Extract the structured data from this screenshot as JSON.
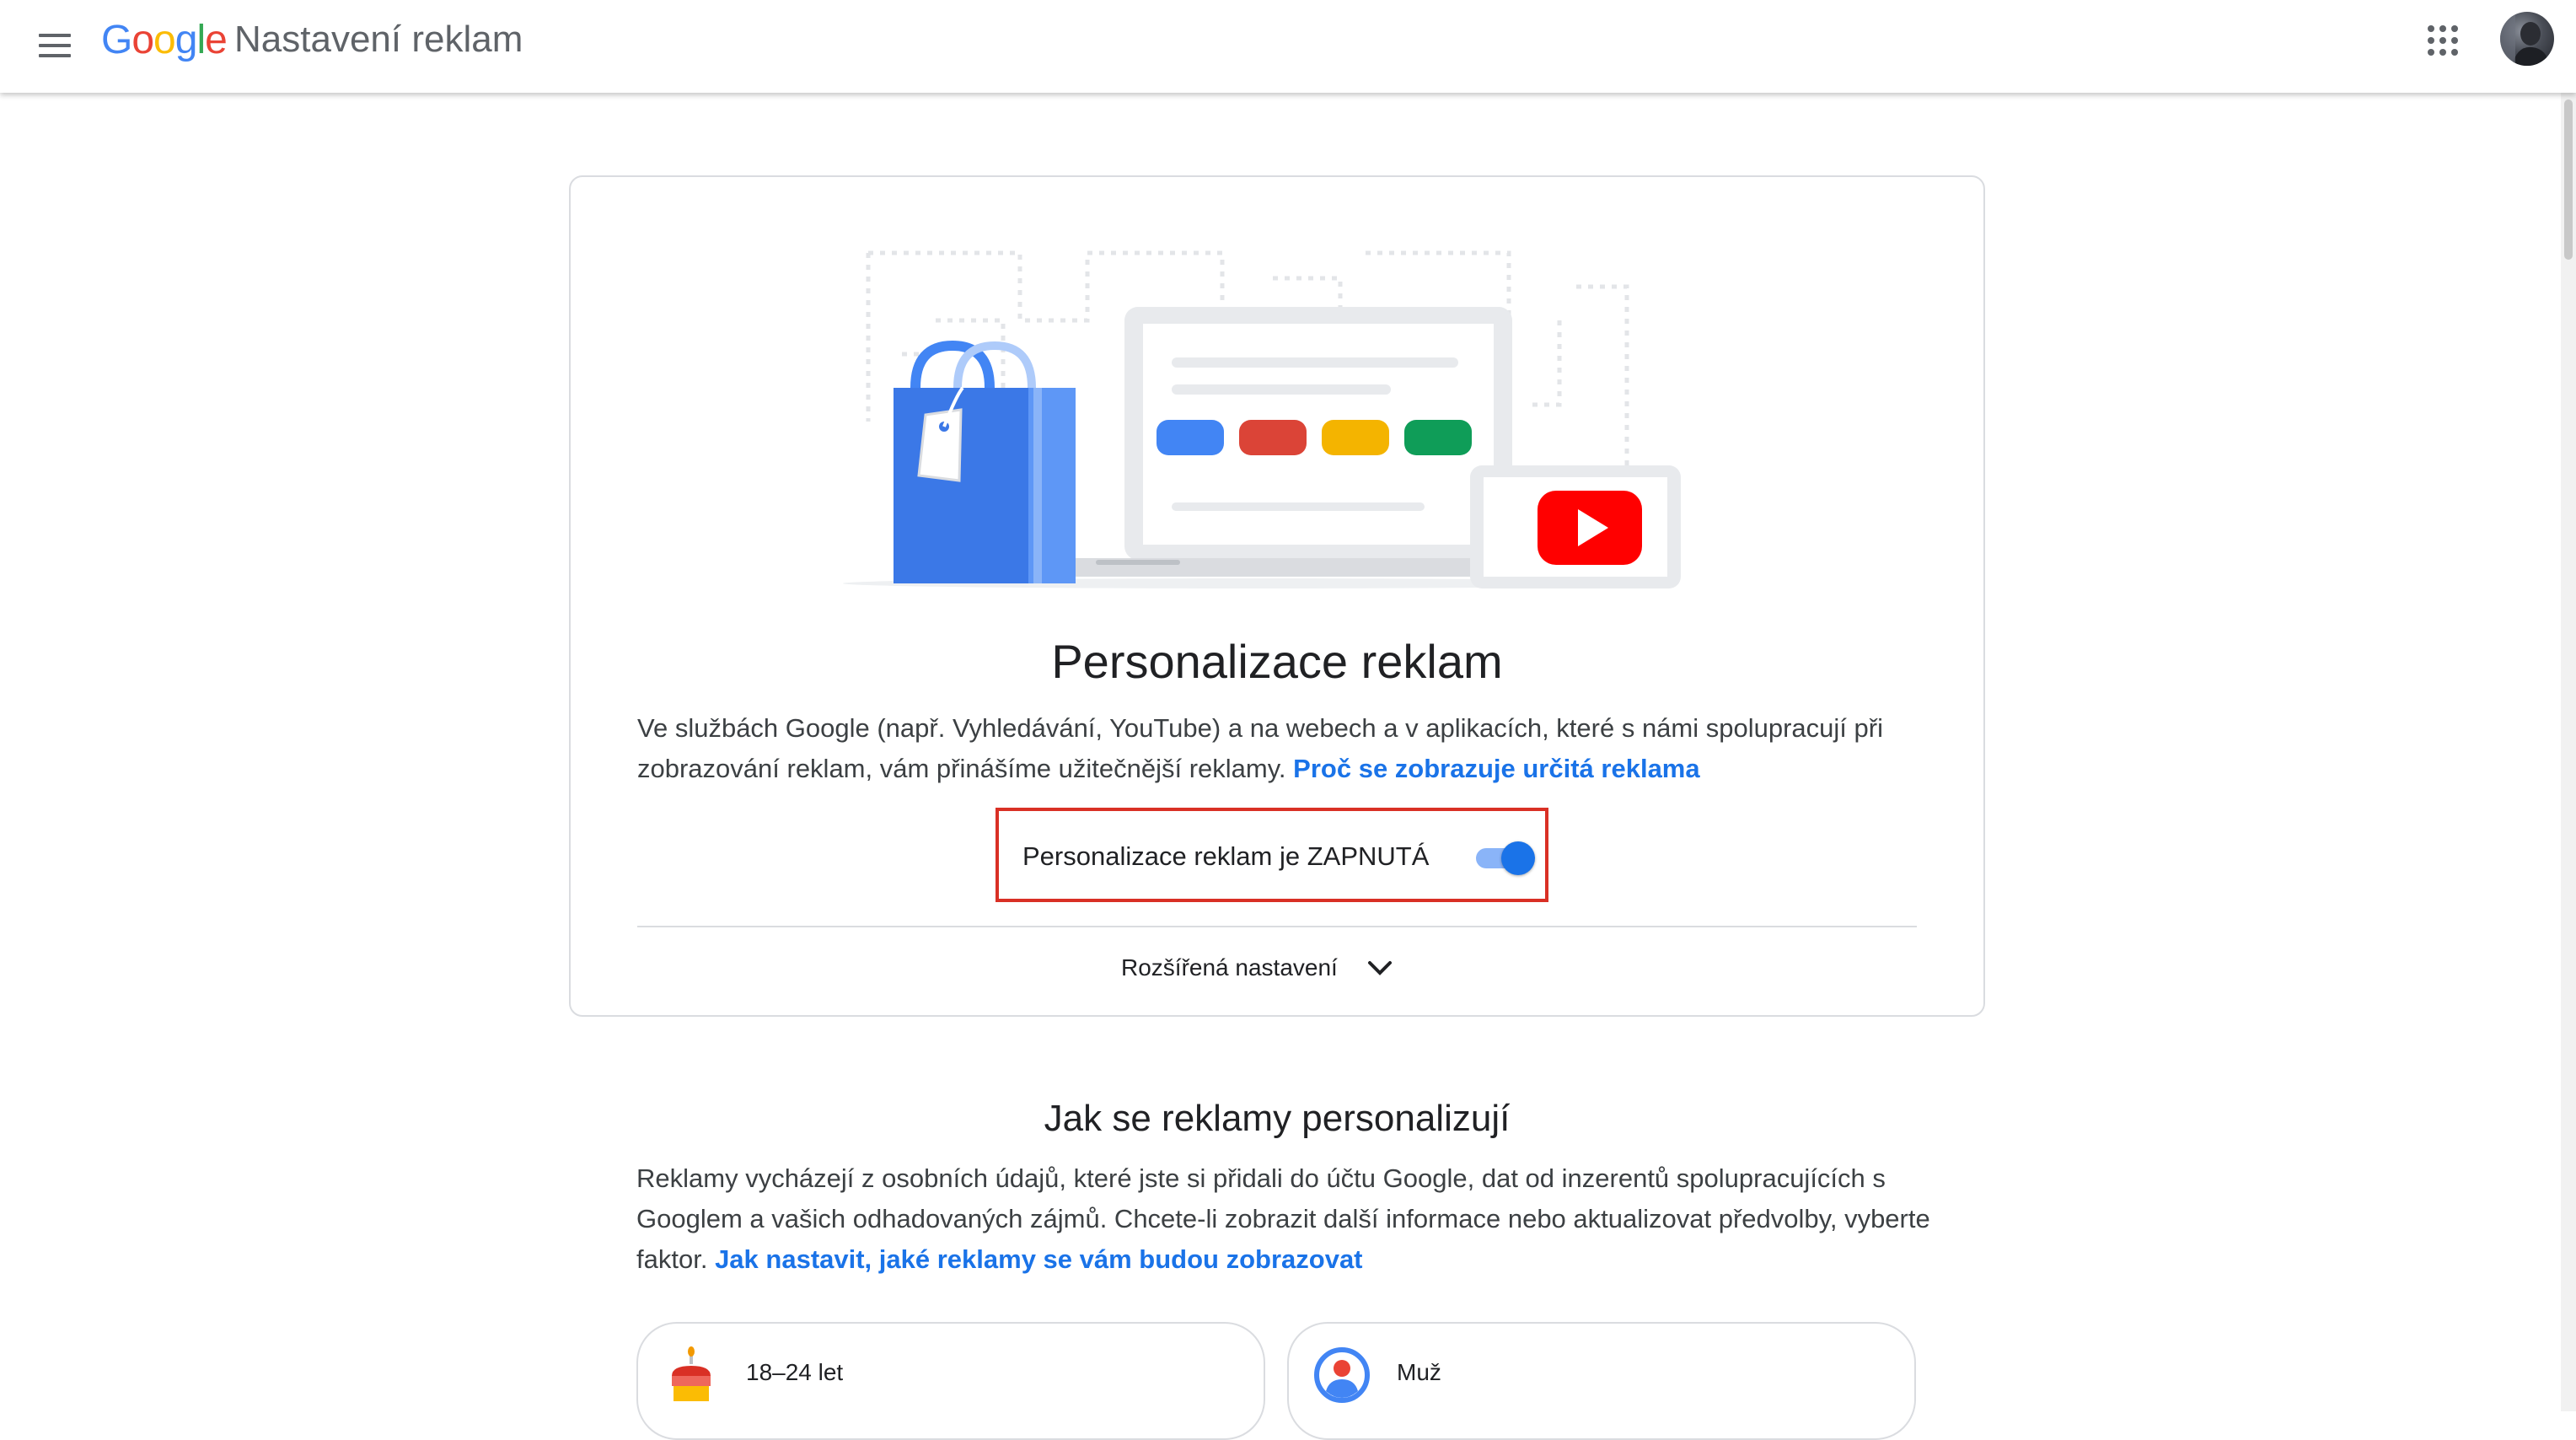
{
  "header": {
    "logo_letters": [
      {
        "ch": "G",
        "color": "#4285F4"
      },
      {
        "ch": "o",
        "color": "#EA4335"
      },
      {
        "ch": "o",
        "color": "#FBBC05"
      },
      {
        "ch": "g",
        "color": "#4285F4"
      },
      {
        "ch": "l",
        "color": "#34A853"
      },
      {
        "ch": "e",
        "color": "#EA4335"
      }
    ],
    "app_title": "Nastavení reklam",
    "menu_icon": "hamburger-menu-icon",
    "apps_icon": "apps-grid-icon",
    "avatar_icon": "account-avatar"
  },
  "card": {
    "title": "Personalizace reklam",
    "description": "Ve službách Google (např. Vyhledávání, YouTube) a na webech a v aplikacích, které s námi spolupracují při zobrazování reklam, vám přinášíme užitečnější reklamy.",
    "description_link": "Proč se zobrazuje určitá reklama",
    "toggle_label": "Personalizace reklam je ZAPNUTÁ",
    "toggle_on": true,
    "advanced_label": "Rozšířená nastavení",
    "illustration_colors": [
      "#4285F4",
      "#DB4437",
      "#F4B400",
      "#0F9D58"
    ]
  },
  "section": {
    "title": "Jak se reklamy personalizují",
    "description": "Reklamy vycházejí z osobních údajů, které jste si přidali do účtu Google, dat od inzerentů spolupracujících s Googlem a vašich odhadovaných zájmů. Chcete-li zobrazit další informace nebo aktualizovat předvolby, vyberte faktor.",
    "description_link": "Jak nastavit, jaké reklamy se vám budou zobrazovat",
    "factors": [
      {
        "label": "18–24 let",
        "icon": "birthday-cake-icon"
      },
      {
        "label": "Muž",
        "icon": "person-icon"
      }
    ]
  },
  "colors": {
    "accent": "#1a73e8",
    "highlight_border": "#d93025",
    "youtube_red": "#FF0000"
  }
}
